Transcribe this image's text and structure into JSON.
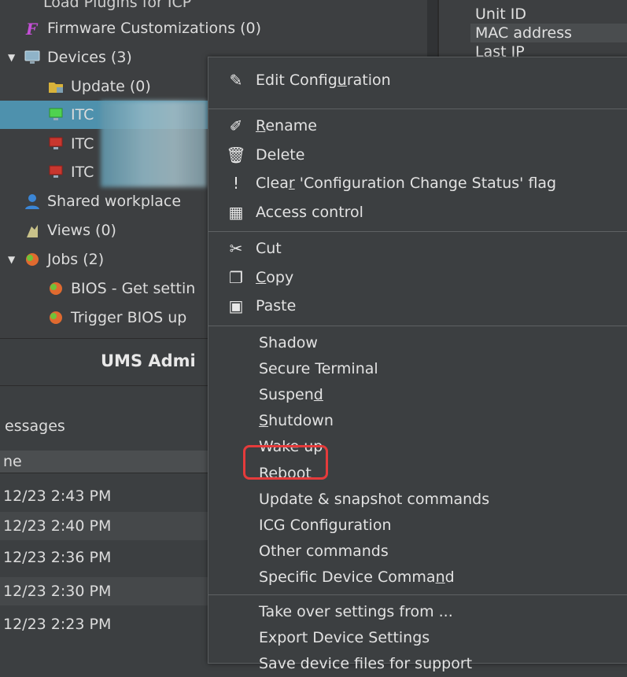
{
  "tree": {
    "partial_top": "Load Plugins for ICP",
    "items": [
      {
        "label": "Firmware Customizations (0)",
        "icon": "firmware-icon",
        "indent": 1
      },
      {
        "label": "Devices (3)",
        "icon": "monitor-icon",
        "indent": 0,
        "expanded": true
      },
      {
        "label": "Update (0)",
        "icon": "folder-icon",
        "indent": 2
      },
      {
        "label": "ITC",
        "icon": "device-green-icon",
        "indent": 2,
        "selected": true
      },
      {
        "label": "ITC",
        "icon": "device-red-icon",
        "indent": 2
      },
      {
        "label": "ITC",
        "icon": "device-red-icon",
        "indent": 2
      },
      {
        "label": "Shared workplace",
        "icon": "user-icon",
        "indent": 1
      },
      {
        "label": "Views (0)",
        "icon": "views-icon",
        "indent": 1
      },
      {
        "label": "Jobs (2)",
        "icon": "jobs-icon",
        "indent": 0,
        "expanded": true
      },
      {
        "label": "BIOS - Get settin",
        "icon": "job-icon",
        "indent": 2
      },
      {
        "label": "Trigger BIOS up",
        "icon": "job-icon",
        "indent": 2
      }
    ]
  },
  "info_panel": {
    "rows": [
      "Unit ID",
      "MAC address",
      "Last IP"
    ]
  },
  "admin": {
    "title": "UMS Admi"
  },
  "messages": {
    "label": "essages",
    "column": "ne",
    "rows": [
      "12/23 2:43 PM",
      "12/23 2:40 PM",
      "12/23 2:36 PM",
      "12/23 2:30 PM",
      "12/23 2:23 PM"
    ]
  },
  "context_menu": {
    "groups": [
      [
        {
          "label": "Edit Configuration",
          "icon": "wrench-icon",
          "underline": "u"
        }
      ],
      [
        {
          "label": "Rename",
          "icon": "pencil-icon",
          "underline": "R"
        },
        {
          "label": "Delete",
          "icon": "trash-icon"
        },
        {
          "label": "Clear 'Configuration Change Status' flag",
          "icon": "exclamation-icon",
          "underline": "r"
        },
        {
          "label": "Access control",
          "icon": "access-control-icon"
        }
      ],
      [
        {
          "label": "Cut",
          "icon": "scissors-icon"
        },
        {
          "label": "Copy",
          "icon": "copy-icon",
          "underline": "C"
        },
        {
          "label": "Paste",
          "icon": "paste-icon"
        }
      ],
      [
        {
          "label": "Shadow"
        },
        {
          "label": "Secure Terminal"
        },
        {
          "label": "Suspend",
          "underline": "d"
        },
        {
          "label": "Shutdown",
          "underline": "S"
        },
        {
          "label": "Wake up"
        },
        {
          "label": "Reboot",
          "underline": "t",
          "highlighted": true
        },
        {
          "label": "Update & snapshot commands"
        },
        {
          "label": "ICG Configuration"
        },
        {
          "label": "Other commands"
        },
        {
          "label": "Specific Device Command",
          "underline": "n"
        }
      ],
      [
        {
          "label": "Take over settings from ..."
        },
        {
          "label": "Export Device Settings"
        },
        {
          "label": "Save device files for support"
        }
      ]
    ]
  },
  "colors": {
    "background": "#3c3f41",
    "selection": "#4e91ad",
    "highlight_border": "#e53b3b"
  }
}
